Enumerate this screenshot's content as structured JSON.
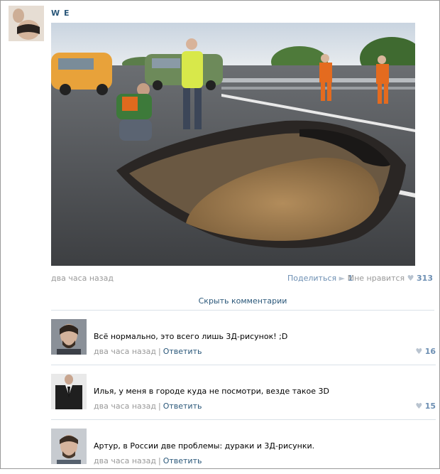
{
  "post": {
    "author": "W  E",
    "time": "два часа назад",
    "share_label": "Поделиться",
    "share_count": "1",
    "like_label": "Мне нравится",
    "like_count": "313",
    "icons": {
      "share": "megaphone-icon",
      "like": "heart-icon"
    }
  },
  "hide_comments": "Скрыть комментарии",
  "comments": [
    {
      "text": "Всё нормально, это всего лишь 3Д-рисунок! ;D",
      "time": "два часа назад",
      "reply": "Ответить",
      "likes": "16"
    },
    {
      "text": "Илья, у меня в городе куда не посмотри, везде такое 3D",
      "time": "два часа назад",
      "reply": "Ответить",
      "likes": "15"
    },
    {
      "text": "Артур, в России две проблемы: дураки и 3Д-рисунки.",
      "time": "два часа назад",
      "reply": "Ответить",
      "likes": ""
    }
  ],
  "colors": {
    "link": "#2b587a",
    "muted": "#999999",
    "count": "#6d8fb3",
    "divider": "#dae1e8"
  }
}
